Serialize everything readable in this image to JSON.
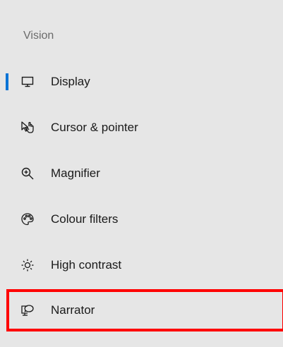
{
  "sidebar": {
    "section_title": "Vision",
    "items": [
      {
        "label": "Display",
        "icon": "display-icon",
        "active": true
      },
      {
        "label": "Cursor & pointer",
        "icon": "cursor-pointer-icon",
        "active": false
      },
      {
        "label": "Magnifier",
        "icon": "magnifier-icon",
        "active": false
      },
      {
        "label": "Colour filters",
        "icon": "palette-icon",
        "active": false
      },
      {
        "label": "High contrast",
        "icon": "sun-contrast-icon",
        "active": false
      },
      {
        "label": "Narrator",
        "icon": "narrator-icon",
        "active": false
      }
    ]
  },
  "colors": {
    "accent": "#0a74d6",
    "highlight": "#ff0000",
    "background": "#e6e6e6"
  }
}
